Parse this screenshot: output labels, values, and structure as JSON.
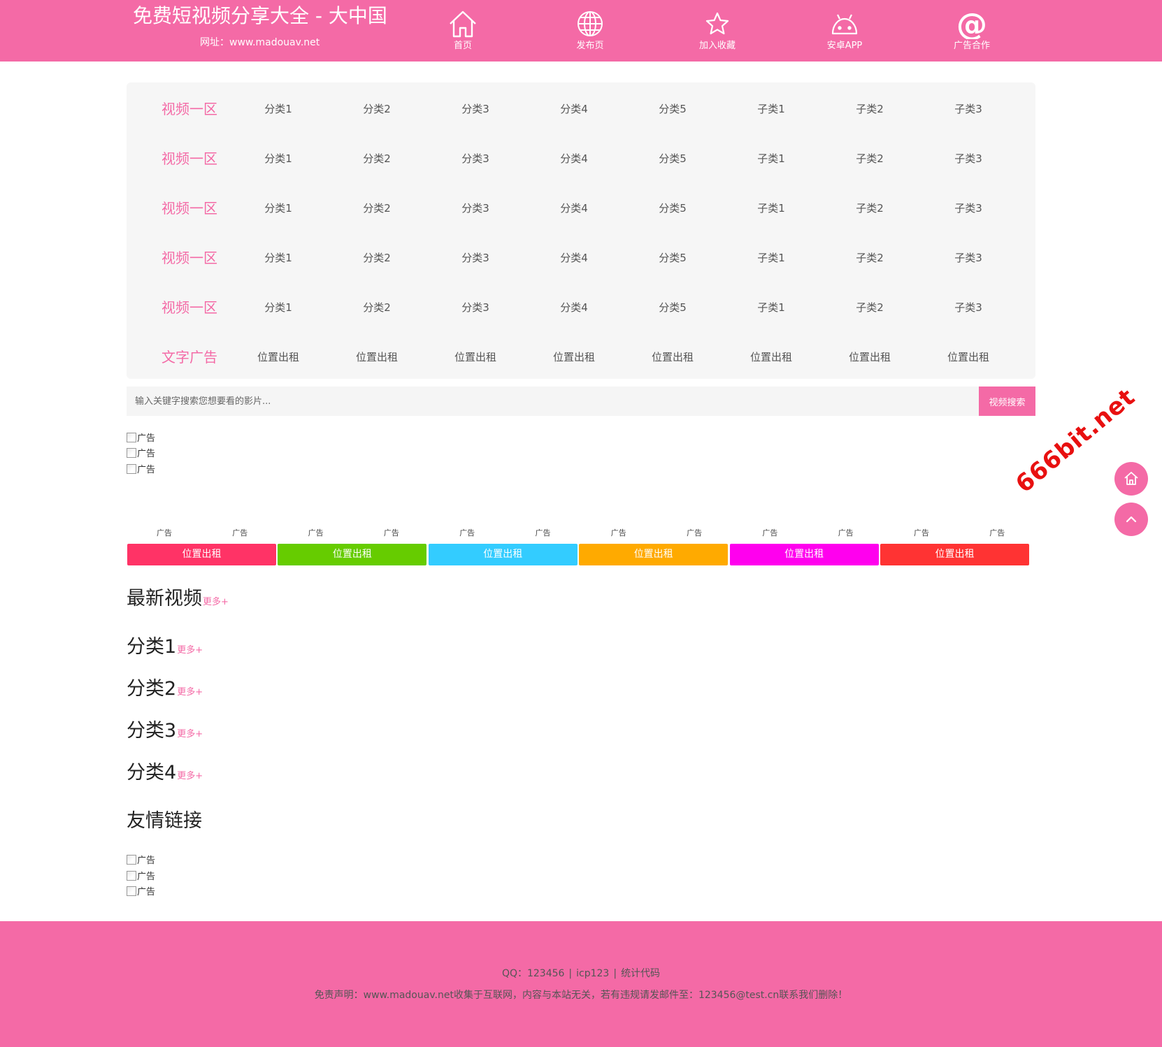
{
  "header": {
    "title": "免费短视频分享大全 - 大中国",
    "url_line": "网址：www.madouav.net",
    "nav": [
      {
        "label": "首页",
        "icon": "home-icon"
      },
      {
        "label": "发布页",
        "icon": "globe-icon"
      },
      {
        "label": "加入收藏",
        "icon": "star-icon"
      },
      {
        "label": "安卓APP",
        "icon": "android-icon"
      },
      {
        "label": "广告合作",
        "icon": "at-icon"
      }
    ]
  },
  "categories": {
    "rows": [
      {
        "head": "视频一区",
        "links": [
          "分类1",
          "分类2",
          "分类3",
          "分类4",
          "分类5",
          "子类1",
          "子类2",
          "子类3"
        ]
      },
      {
        "head": "视频一区",
        "links": [
          "分类1",
          "分类2",
          "分类3",
          "分类4",
          "分类5",
          "子类1",
          "子类2",
          "子类3"
        ]
      },
      {
        "head": "视频一区",
        "links": [
          "分类1",
          "分类2",
          "分类3",
          "分类4",
          "分类5",
          "子类1",
          "子类2",
          "子类3"
        ]
      },
      {
        "head": "视频一区",
        "links": [
          "分类1",
          "分类2",
          "分类3",
          "分类4",
          "分类5",
          "子类1",
          "子类2",
          "子类3"
        ]
      },
      {
        "head": "视频一区",
        "links": [
          "分类1",
          "分类2",
          "分类3",
          "分类4",
          "分类5",
          "子类1",
          "子类2",
          "子类3"
        ]
      },
      {
        "head": "文字广告",
        "links": [
          "位置出租",
          "位置出租",
          "位置出租",
          "位置出租",
          "位置出租",
          "位置出租",
          "位置出租",
          "位置出租"
        ]
      }
    ]
  },
  "search": {
    "placeholder": "输入关键字搜索您想要看的影片...",
    "button_label": "视频搜索"
  },
  "top_ads": [
    "广告",
    "广告",
    "广告"
  ],
  "small_ads": [
    "广告",
    "广告",
    "广告",
    "广告",
    "广告",
    "广告",
    "广告",
    "广告",
    "广告",
    "广告",
    "广告",
    "广告"
  ],
  "rent_buttons": [
    {
      "label": "位置出租",
      "color": "#ff3366"
    },
    {
      "label": "位置出租",
      "color": "#66cc00"
    },
    {
      "label": "位置出租",
      "color": "#33ccff"
    },
    {
      "label": "位置出租",
      "color": "#ffaa00"
    },
    {
      "label": "位置出租",
      "color": "#ff00ee"
    },
    {
      "label": "位置出租",
      "color": "#ff3333"
    }
  ],
  "sections": [
    {
      "title": "最新视频",
      "more": "更多+"
    },
    {
      "title": "分类1",
      "more": "更多+"
    },
    {
      "title": "分类2",
      "more": "更多+"
    },
    {
      "title": "分类3",
      "more": "更多+"
    },
    {
      "title": "分类4",
      "more": "更多+"
    }
  ],
  "friend_links": {
    "title": "友情链接",
    "ads": [
      "广告",
      "广告",
      "广告"
    ]
  },
  "watermark": "666bit.net",
  "footer": {
    "qq": "QQ：123456",
    "icp": "icp123",
    "stats": "统计代码",
    "separator": "|",
    "disclaimer": "免责声明：www.madouav.net收集于互联网，内容与本站无关，若有违规请发邮件至：123456@test.cn联系我们删除！"
  },
  "colors": {
    "brand": "#f46aa6",
    "category_bg": "#f6f6f6",
    "watermark": "#e81010"
  }
}
